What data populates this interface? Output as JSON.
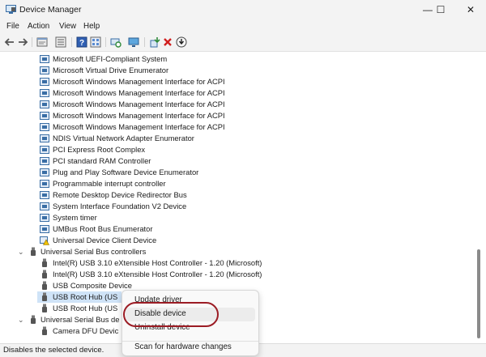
{
  "window": {
    "title": "Device Manager",
    "minimize_glyph": "—",
    "maximize_glyph": "☐",
    "close_glyph": "✕"
  },
  "menu": [
    "File",
    "Action",
    "View",
    "Help"
  ],
  "toolbar": {
    "icons": [
      "back-arrow-icon",
      "forward-arrow-icon",
      "properties-icon",
      "list-view-icon",
      "help-icon",
      "details-icon",
      "scan-hardware-icon",
      "monitor-icon",
      "update-driver-icon",
      "uninstall-x-icon",
      "disable-device-icon"
    ]
  },
  "tree": {
    "system_devices": [
      "Microsoft UEFI-Compliant System",
      "Microsoft Virtual Drive Enumerator",
      "Microsoft Windows Management Interface for ACPI",
      "Microsoft Windows Management Interface for ACPI",
      "Microsoft Windows Management Interface for ACPI",
      "Microsoft Windows Management Interface for ACPI",
      "Microsoft Windows Management Interface for ACPI",
      "NDIS Virtual Network Adapter Enumerator",
      "PCI Express Root Complex",
      "PCI standard RAM Controller",
      "Plug and Play Software Device Enumerator",
      "Programmable interrupt controller",
      "Remote Desktop Device Redirector Bus",
      "System Interface Foundation V2 Device",
      "System timer",
      "UMBus Root Bus Enumerator",
      "Universal Device Client Device"
    ],
    "usb_category": "Universal Serial Bus controllers",
    "usb_devices": [
      "Intel(R) USB 3.10 eXtensible Host Controller - 1.20 (Microsoft)",
      "Intel(R) USB 3.10 eXtensible Host Controller - 1.20 (Microsoft)",
      "USB Composite Device",
      "USB Root Hub (US",
      "USB Root Hub (US"
    ],
    "usb_dev_category": "Universal Serial Bus de",
    "usb_dev_devices": [
      "Camera DFU Devic"
    ]
  },
  "context_menu": {
    "items": [
      "Update driver",
      "Disable device",
      "Uninstall device",
      "Scan for hardware changes"
    ]
  },
  "status_bar": {
    "text": "Disables the selected device."
  },
  "colors": {
    "accent_ring": "#9b1c24",
    "selection": "#cfe3f7",
    "chrome": "#f3f3f3"
  }
}
